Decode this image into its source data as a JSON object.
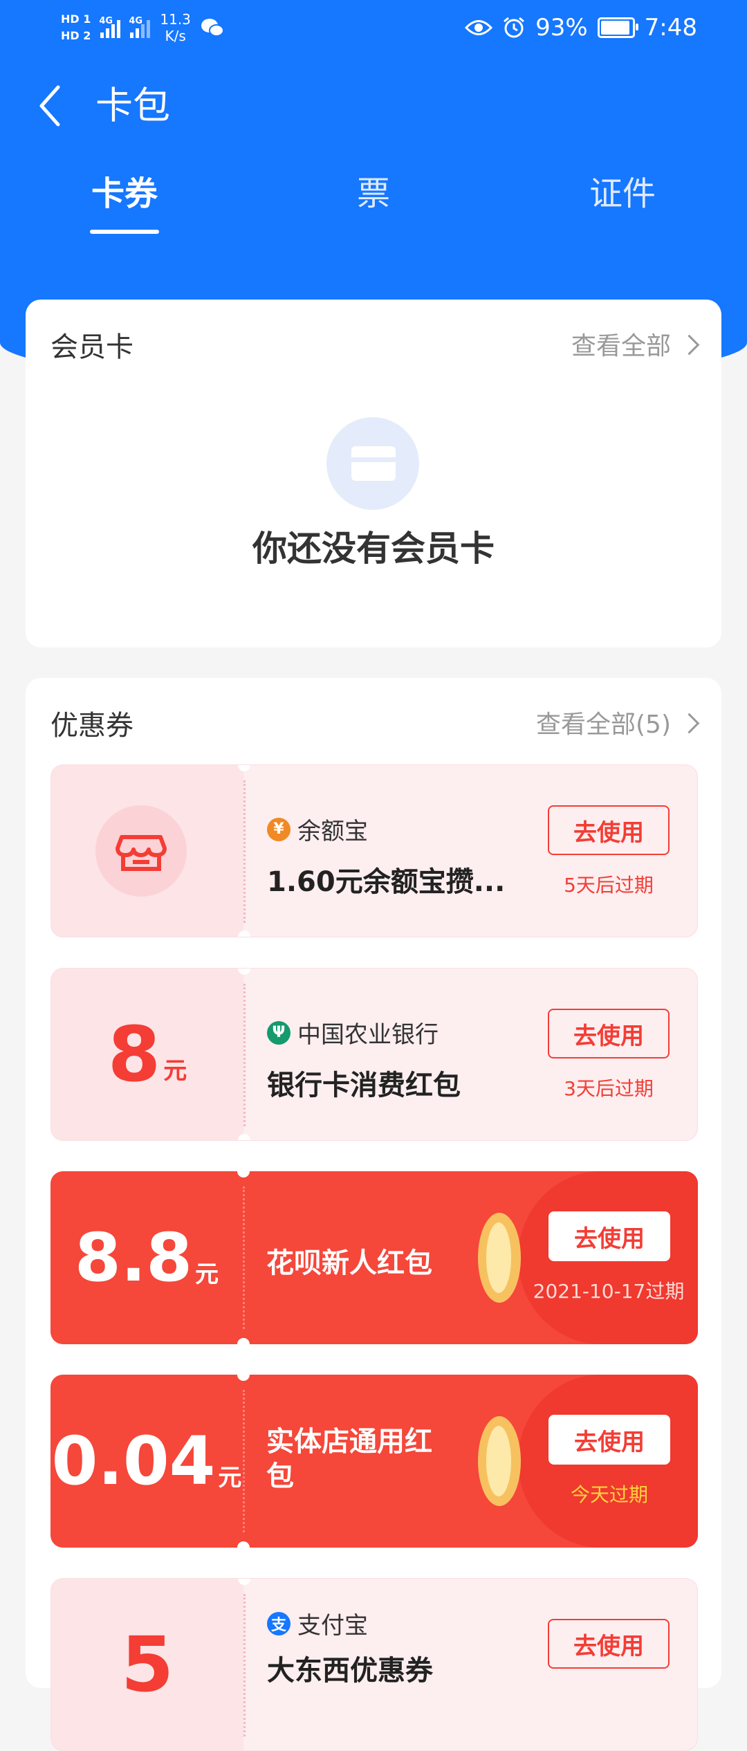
{
  "status_bar": {
    "hd1": "HD 1",
    "hd2": "HD 2",
    "net1": "4G",
    "net2": "4G",
    "speed_value": "11.3",
    "speed_unit": "K/s",
    "battery": "93%",
    "time": "7:48"
  },
  "header": {
    "title": "卡包"
  },
  "tabs": [
    {
      "label": "卡券",
      "active": true
    },
    {
      "label": "票",
      "active": false
    },
    {
      "label": "证件",
      "active": false
    }
  ],
  "member_card": {
    "title": "会员卡",
    "see_all": "查看全部",
    "empty_text": "你还没有会员卡"
  },
  "coupons": {
    "title": "优惠券",
    "see_all": "查看全部(5)",
    "items": [
      {
        "brand": "余额宝",
        "name": "1.60元余额宝攒...",
        "button": "去使用",
        "expire": "5天后过期",
        "icon": "shop-icon",
        "style": "pink"
      },
      {
        "amount": "8",
        "unit": "元",
        "brand": "中国农业银行",
        "name": "银行卡消费红包",
        "button": "去使用",
        "expire": "3天后过期",
        "style": "pink"
      },
      {
        "amount": "8.8",
        "unit": "元",
        "name": "花呗新人红包",
        "button": "去使用",
        "expire": "2021-10-17过期",
        "style": "red"
      },
      {
        "amount": "0.04",
        "unit": "元",
        "name_line1": "实体店通用红",
        "name_line2": "包",
        "button": "去使用",
        "expire": "今天过期",
        "style": "red"
      },
      {
        "amount": "5",
        "brand": "支付宝",
        "name": "大东西优惠券",
        "button": "去使用",
        "style": "pink"
      }
    ]
  },
  "colors": {
    "primary": "#1677ff",
    "coupon_red": "#f5473a",
    "accent_red": "#f33d35"
  }
}
